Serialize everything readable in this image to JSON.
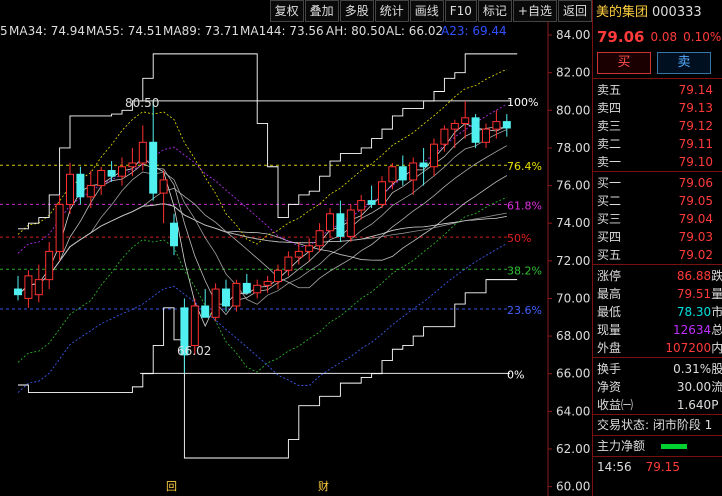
{
  "toolbar": [
    "复权",
    "叠加",
    "多股",
    "统计",
    "画线",
    "F10",
    "标记",
    "+自选",
    "返回"
  ],
  "ma_bar": {
    "prefix": "5",
    "ma34": "MA34: 74.94",
    "ma55": "MA55: 74.51",
    "ma89": "MA89: 73.71",
    "ma144": "MA144: 73.56",
    "ah": "AH: 80.50",
    "al": "AL: 66.02",
    "a23": "A23: 69.44"
  },
  "fib": {
    "high_label": "80.50",
    "low_label": "66.02",
    "levels": [
      {
        "pct": "100%",
        "price": 80.5,
        "color": "#ffffff"
      },
      {
        "pct": "76.4%",
        "price": 77.08,
        "color": "#e8e000"
      },
      {
        "pct": "61.8%",
        "price": 75.0,
        "color": "#e030e0"
      },
      {
        "pct": "50%",
        "price": 73.26,
        "color": "#e02020"
      },
      {
        "pct": "38.2%",
        "price": 71.55,
        "color": "#30c030"
      },
      {
        "pct": "23.6%",
        "price": 69.44,
        "color": "#4060ff"
      },
      {
        "pct": "0%",
        "price": 66.02,
        "color": "#ffffff"
      }
    ]
  },
  "axis_ticks": [
    "84.00",
    "82.00",
    "80.00",
    "78.00",
    "76.00",
    "74.00",
    "72.00",
    "70.00",
    "68.00",
    "66.00",
    "64.00",
    "62.00",
    "60.00"
  ],
  "bottom_markers": {
    "hui": "回",
    "cai": "财"
  },
  "chart_data": {
    "type": "candlestick",
    "ylim": [
      59.5,
      84.8
    ],
    "candles": [
      {
        "o": 70.5,
        "h": 71.2,
        "l": 69.9,
        "c": 70.2
      },
      {
        "o": 70.0,
        "h": 71.5,
        "l": 69.5,
        "c": 71.2
      },
      {
        "o": 70.2,
        "h": 71.8,
        "l": 69.8,
        "c": 71.0
      },
      {
        "o": 71.0,
        "h": 73.0,
        "l": 70.5,
        "c": 72.5
      },
      {
        "o": 72.5,
        "h": 75.5,
        "l": 72.0,
        "c": 75.0
      },
      {
        "o": 75.0,
        "h": 77.2,
        "l": 74.5,
        "c": 76.6
      },
      {
        "o": 76.6,
        "h": 77.0,
        "l": 75.0,
        "c": 75.4
      },
      {
        "o": 75.4,
        "h": 76.8,
        "l": 74.8,
        "c": 76.0
      },
      {
        "o": 76.0,
        "h": 77.0,
        "l": 75.5,
        "c": 76.8
      },
      {
        "o": 76.8,
        "h": 77.3,
        "l": 76.2,
        "c": 76.5
      },
      {
        "o": 76.5,
        "h": 77.5,
        "l": 76.0,
        "c": 77.0
      },
      {
        "o": 77.0,
        "h": 78.0,
        "l": 76.5,
        "c": 77.2
      },
      {
        "o": 77.2,
        "h": 79.2,
        "l": 76.8,
        "c": 78.3
      },
      {
        "o": 78.3,
        "h": 80.5,
        "l": 75.2,
        "c": 75.6
      },
      {
        "o": 75.6,
        "h": 76.8,
        "l": 74.0,
        "c": 76.3
      },
      {
        "o": 74.0,
        "h": 74.5,
        "l": 72.3,
        "c": 72.8
      },
      {
        "o": 69.5,
        "h": 70.0,
        "l": 66.02,
        "c": 67.0
      },
      {
        "o": 67.5,
        "h": 70.0,
        "l": 67.0,
        "c": 69.6
      },
      {
        "o": 69.6,
        "h": 70.5,
        "l": 69.0,
        "c": 69.0
      },
      {
        "o": 69.0,
        "h": 70.8,
        "l": 68.8,
        "c": 70.5
      },
      {
        "o": 70.5,
        "h": 71.0,
        "l": 69.3,
        "c": 69.6
      },
      {
        "o": 69.6,
        "h": 71.0,
        "l": 69.3,
        "c": 70.8
      },
      {
        "o": 70.8,
        "h": 71.3,
        "l": 70.2,
        "c": 70.3
      },
      {
        "o": 70.3,
        "h": 71.0,
        "l": 70.0,
        "c": 70.7
      },
      {
        "o": 70.7,
        "h": 71.2,
        "l": 70.3,
        "c": 70.9
      },
      {
        "o": 70.9,
        "h": 71.8,
        "l": 70.5,
        "c": 71.5
      },
      {
        "o": 71.5,
        "h": 72.5,
        "l": 71.2,
        "c": 72.2
      },
      {
        "o": 72.2,
        "h": 73.0,
        "l": 71.8,
        "c": 72.5
      },
      {
        "o": 72.5,
        "h": 73.2,
        "l": 72.0,
        "c": 72.8
      },
      {
        "o": 72.8,
        "h": 74.0,
        "l": 72.5,
        "c": 73.6
      },
      {
        "o": 73.6,
        "h": 74.8,
        "l": 73.2,
        "c": 74.5
      },
      {
        "o": 74.5,
        "h": 75.2,
        "l": 73.0,
        "c": 73.3
      },
      {
        "o": 73.3,
        "h": 75.0,
        "l": 73.0,
        "c": 74.7
      },
      {
        "o": 74.7,
        "h": 75.5,
        "l": 74.2,
        "c": 75.2
      },
      {
        "o": 75.2,
        "h": 76.0,
        "l": 74.8,
        "c": 75.0
      },
      {
        "o": 75.0,
        "h": 76.5,
        "l": 74.8,
        "c": 76.2
      },
      {
        "o": 76.2,
        "h": 77.2,
        "l": 75.8,
        "c": 77.0
      },
      {
        "o": 77.0,
        "h": 77.6,
        "l": 76.0,
        "c": 76.3
      },
      {
        "o": 76.3,
        "h": 77.5,
        "l": 75.5,
        "c": 77.2
      },
      {
        "o": 77.2,
        "h": 78.0,
        "l": 76.0,
        "c": 77.0
      },
      {
        "o": 77.0,
        "h": 78.5,
        "l": 76.5,
        "c": 78.2
      },
      {
        "o": 78.2,
        "h": 79.2,
        "l": 77.8,
        "c": 79.0
      },
      {
        "o": 79.0,
        "h": 79.5,
        "l": 78.0,
        "c": 79.3
      },
      {
        "o": 79.3,
        "h": 80.5,
        "l": 78.5,
        "c": 79.6
      },
      {
        "o": 79.6,
        "h": 79.8,
        "l": 78.0,
        "c": 78.3
      },
      {
        "o": 78.3,
        "h": 79.3,
        "l": 78.0,
        "c": 79.0
      },
      {
        "o": 79.0,
        "h": 80.0,
        "l": 78.5,
        "c": 79.4
      },
      {
        "o": 79.4,
        "h": 79.8,
        "l": 78.6,
        "c": 79.06
      }
    ]
  },
  "stock": {
    "name": "美的集团",
    "code": "000333",
    "price": "79.06",
    "change": "0.08",
    "change_pct": "0.10%"
  },
  "buttons": {
    "buy": "买",
    "sell": "卖"
  },
  "asks": [
    {
      "label": "卖五",
      "price": "79.14"
    },
    {
      "label": "卖四",
      "price": "79.13"
    },
    {
      "label": "卖三",
      "price": "79.12"
    },
    {
      "label": "卖二",
      "price": "79.11"
    },
    {
      "label": "卖一",
      "price": "79.10"
    }
  ],
  "bids": [
    {
      "label": "买一",
      "price": "79.06"
    },
    {
      "label": "买二",
      "price": "79.05"
    },
    {
      "label": "买三",
      "price": "79.04"
    },
    {
      "label": "买四",
      "price": "79.03"
    },
    {
      "label": "买五",
      "price": "79.02"
    }
  ],
  "stats1": [
    {
      "label": "涨停",
      "value": "86.88",
      "color": "red",
      "tail": "跌"
    },
    {
      "label": "最高",
      "value": "79.51",
      "color": "red",
      "tail": "量"
    },
    {
      "label": "最低",
      "value": "78.30",
      "color": "green",
      "tail": "市"
    },
    {
      "label": "现量",
      "value": "12634",
      "color": "purple",
      "tail": "总"
    },
    {
      "label": "外盘",
      "value": "107200",
      "color": "red",
      "tail": "内"
    }
  ],
  "stats2": [
    {
      "label": "换手",
      "value": "0.31%",
      "color": "white",
      "tail": "股"
    },
    {
      "label": "净资",
      "value": "30.00",
      "color": "white",
      "tail": "流"
    },
    {
      "label": "收益㈠",
      "value": "1.640",
      "color": "white",
      "tail": "P"
    }
  ],
  "trade_status": "交易状态: 闭市阶段 1",
  "net_flow": "主力净额",
  "tick": {
    "time": "14:56",
    "price": "79.15"
  }
}
